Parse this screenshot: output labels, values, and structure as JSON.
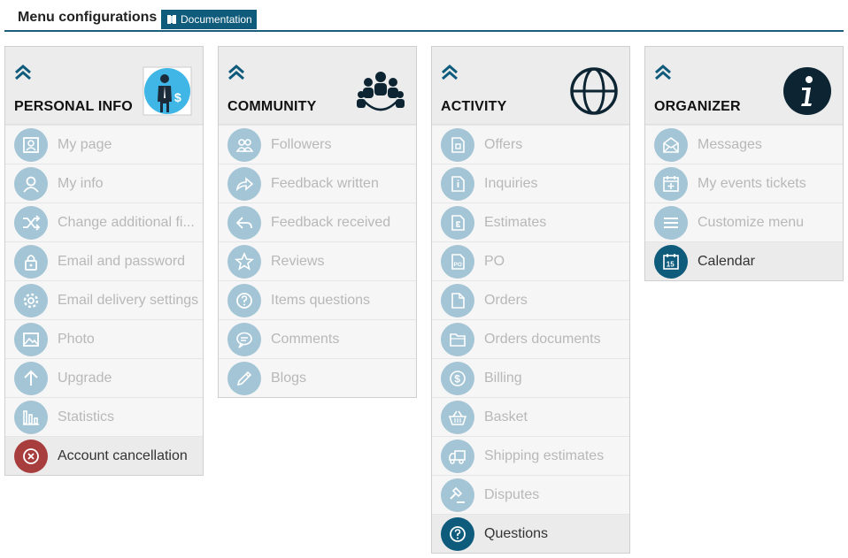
{
  "header": {
    "title": "Menu configurations",
    "doc_label": "Documentation"
  },
  "panels": [
    {
      "title": "PERSONAL INFO",
      "items": [
        {
          "label": "My page"
        },
        {
          "label": "My info"
        },
        {
          "label": "Change additional fi..."
        },
        {
          "label": "Email and password"
        },
        {
          "label": "Email delivery settings"
        },
        {
          "label": "Photo"
        },
        {
          "label": "Upgrade"
        },
        {
          "label": "Statistics"
        },
        {
          "label": "Account cancellation"
        }
      ]
    },
    {
      "title": "COMMUNITY",
      "items": [
        {
          "label": "Followers"
        },
        {
          "label": "Feedback written"
        },
        {
          "label": "Feedback received"
        },
        {
          "label": "Reviews"
        },
        {
          "label": "Items questions"
        },
        {
          "label": "Comments"
        },
        {
          "label": "Blogs"
        }
      ]
    },
    {
      "title": "ACTIVITY",
      "items": [
        {
          "label": "Offers"
        },
        {
          "label": "Inquiries"
        },
        {
          "label": "Estimates"
        },
        {
          "label": "PO"
        },
        {
          "label": "Orders"
        },
        {
          "label": "Orders documents"
        },
        {
          "label": "Billing"
        },
        {
          "label": "Basket"
        },
        {
          "label": "Shipping estimates"
        },
        {
          "label": "Disputes"
        },
        {
          "label": "Questions"
        }
      ]
    },
    {
      "title": "ORGANIZER",
      "items": [
        {
          "label": "Messages"
        },
        {
          "label": "My events tickets"
        },
        {
          "label": "Customize menu"
        },
        {
          "label": "Calendar"
        }
      ]
    }
  ],
  "colors": {
    "accent": "#0f5b7c",
    "inactive_icon": "#a3c5d5",
    "danger": "#a83d3d"
  }
}
